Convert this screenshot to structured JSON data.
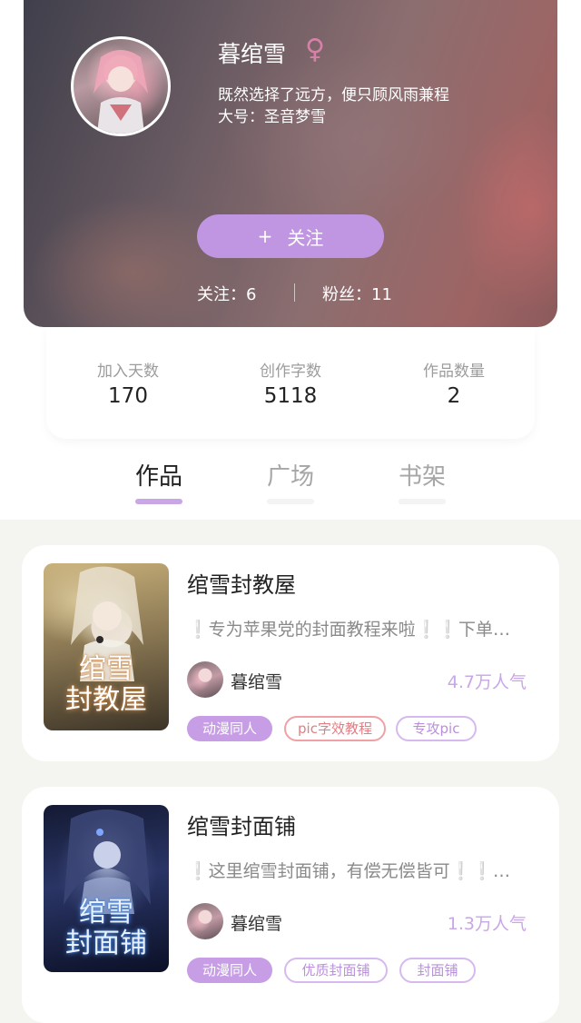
{
  "profile": {
    "name": "暮绾雪",
    "gender_symbol": "♀",
    "bio_line1": "既然选择了远方，便只顾风雨兼程",
    "bio_line2": "大号：圣音梦雪",
    "follow_button": {
      "icon": "+",
      "label": "关注"
    },
    "following": "关注：6",
    "fans": "粉丝：11",
    "colors": {
      "accent": "#c095e2",
      "gender": "#d780a8"
    }
  },
  "stats": [
    {
      "label": "加入天数",
      "value": "170"
    },
    {
      "label": "创作字数",
      "value": "5118"
    },
    {
      "label": "作品数量",
      "value": "2"
    }
  ],
  "tabs": [
    {
      "label": "作品",
      "active": true
    },
    {
      "label": "广场",
      "active": false
    },
    {
      "label": "书架",
      "active": false
    }
  ],
  "works": [
    {
      "title": "绾雪封教屋",
      "cover_text": [
        "绾雪",
        "封教屋"
      ],
      "desc_pre": "❕",
      "desc_text": "专为苹果党的封面教程来啦",
      "desc_post": "❕❕",
      "desc_tail": "下单…",
      "author": "暮绾雪",
      "popularity": "4.7万人气",
      "tags": [
        "动漫同人",
        "pic字效教程",
        "专攻pic"
      ]
    },
    {
      "title": "绾雪封面铺",
      "cover_text": [
        "绾雪",
        "封面铺"
      ],
      "desc_pre": "❕",
      "desc_text": "这里绾雪封面铺，有偿无偿皆可",
      "desc_post": "❕❕",
      "desc_tail": "…",
      "author": "暮绾雪",
      "popularity": "1.3万人气",
      "tags": [
        "动漫同人",
        "优质封面铺",
        "封面铺"
      ]
    }
  ]
}
